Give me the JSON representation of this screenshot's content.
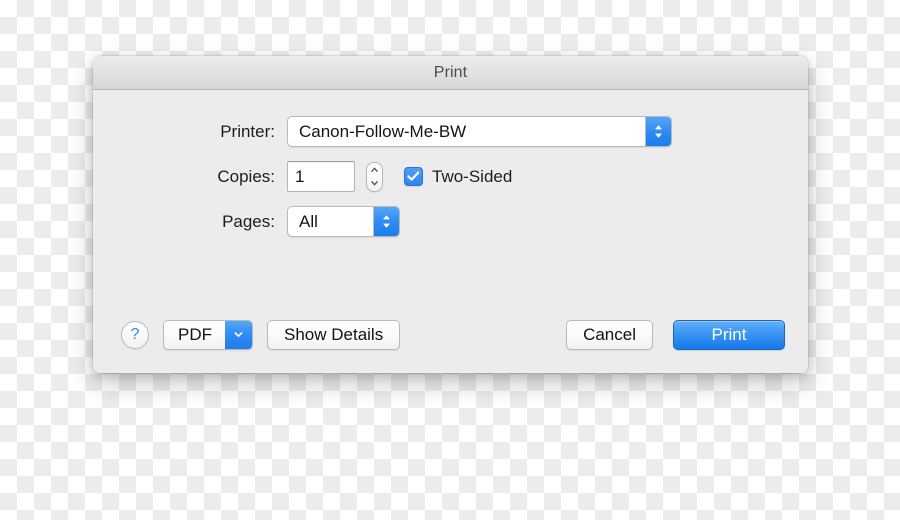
{
  "window": {
    "title": "Print"
  },
  "form": {
    "printer": {
      "label": "Printer:",
      "value": "Canon-Follow-Me-BW",
      "arrow_icon": "chevron-up-down-icon"
    },
    "copies": {
      "label": "Copies:",
      "value": "1",
      "placeholder": "1",
      "stepper_up_icon": "chevron-up-icon",
      "stepper_down_icon": "chevron-down-icon"
    },
    "two_sided": {
      "label": "Two-Sided",
      "checked": true,
      "check_icon": "checkmark-icon"
    },
    "pages": {
      "label": "Pages:",
      "value": "All",
      "arrow_icon": "chevron-up-down-icon"
    }
  },
  "buttons": {
    "help": {
      "label": "?",
      "icon": "question-mark-icon"
    },
    "pdf": {
      "label": "PDF",
      "arrow_icon": "chevron-down-icon"
    },
    "show_details": {
      "label": "Show Details"
    },
    "cancel": {
      "label": "Cancel"
    },
    "print": {
      "label": "Print"
    }
  },
  "colors": {
    "accent_blue": "#2f86f0",
    "default_button_blue": "#1479ea",
    "dialog_background": "#ececec",
    "titlebar_top": "#ebebeb",
    "titlebar_bottom": "#d6d6d6",
    "text_primary": "#1c1c1c",
    "title_text": "#4b4b4b",
    "checker_gray": "#ececec"
  }
}
